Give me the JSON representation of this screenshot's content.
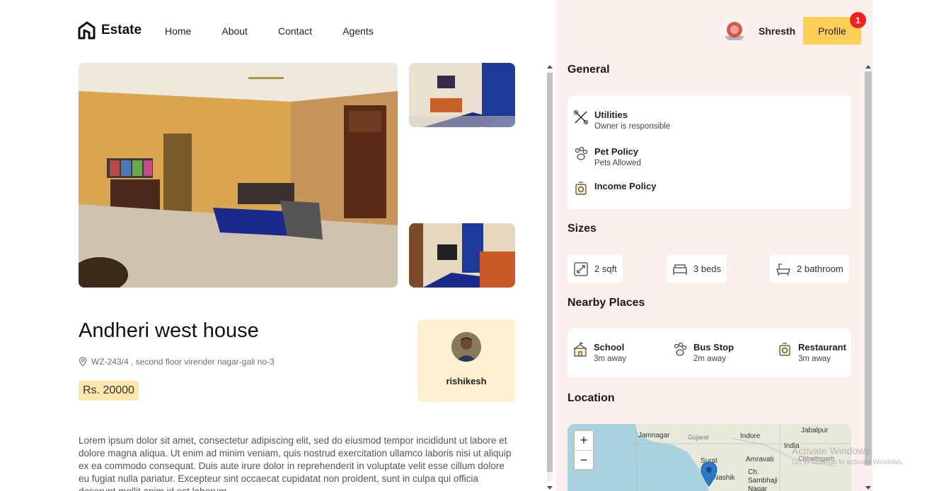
{
  "brand": {
    "name": "Estate"
  },
  "nav": {
    "items": [
      "Home",
      "About",
      "Contact",
      "Agents"
    ]
  },
  "user": {
    "name": "Shresth",
    "profile_label": "Profile",
    "notification_count": "1"
  },
  "property": {
    "title": "Andheri west house",
    "address": "WZ-243/4 , second floor virender nagar-gali no-3",
    "price": "Rs. 20000",
    "description": "Lorem ipsum dolor sit amet, consectetur adipiscing elit, sed do eiusmod tempor incididunt ut labore et dolore magna aliqua. Ut enim ad minim veniam, quis nostrud exercitation ullamco laboris nisi ut aliquip ex ea commodo consequat. Duis aute irure dolor in reprehenderit in voluptate velit esse cillum dolore eu fugiat nulla pariatur. Excepteur sint occaecat cupidatat non proident, sunt in culpa qui officia deserunt mollit anim id est laborum."
  },
  "agent": {
    "name": "rishikesh"
  },
  "general": {
    "heading": "General",
    "items": [
      {
        "title": "Utilities",
        "subtitle": "Owner is responsible",
        "icon": "tools-icon"
      },
      {
        "title": "Pet Policy",
        "subtitle": "Pets Allowed",
        "icon": "paw-icon"
      },
      {
        "title": "Income Policy",
        "subtitle": "",
        "icon": "income-icon"
      }
    ]
  },
  "sizes": {
    "heading": "Sizes",
    "items": [
      {
        "label": "2 sqft",
        "icon": "area-icon"
      },
      {
        "label": "3 beds",
        "icon": "bed-icon"
      },
      {
        "label": "2 bathroom",
        "icon": "bath-icon"
      }
    ]
  },
  "nearby": {
    "heading": "Nearby Places",
    "items": [
      {
        "title": "School",
        "subtitle": "3m away",
        "icon": "school-icon"
      },
      {
        "title": "Bus Stop",
        "subtitle": "2m away",
        "icon": "bus-icon"
      },
      {
        "title": "Restaurant",
        "subtitle": "3m away",
        "icon": "restaurant-icon"
      }
    ]
  },
  "location": {
    "heading": "Location",
    "zoom_in": "+",
    "zoom_out": "−",
    "labels": [
      "Jamnagar",
      "Gujarat",
      "Indore",
      "Jabalpur",
      "India",
      "Surat",
      "Amravati",
      "Chhattisgarh",
      "Ch. Sambhaji Nagar",
      "Nashik"
    ]
  },
  "watermark": {
    "line1": "Activate Windows",
    "line2": "Go to Settings to activate Windows."
  },
  "colors": {
    "accent": "#fcd058",
    "panel_bg": "#fcf0ee",
    "badge": "#f02020",
    "price_bg": "#fbe6ac",
    "agent_bg": "#fdf0d1"
  }
}
